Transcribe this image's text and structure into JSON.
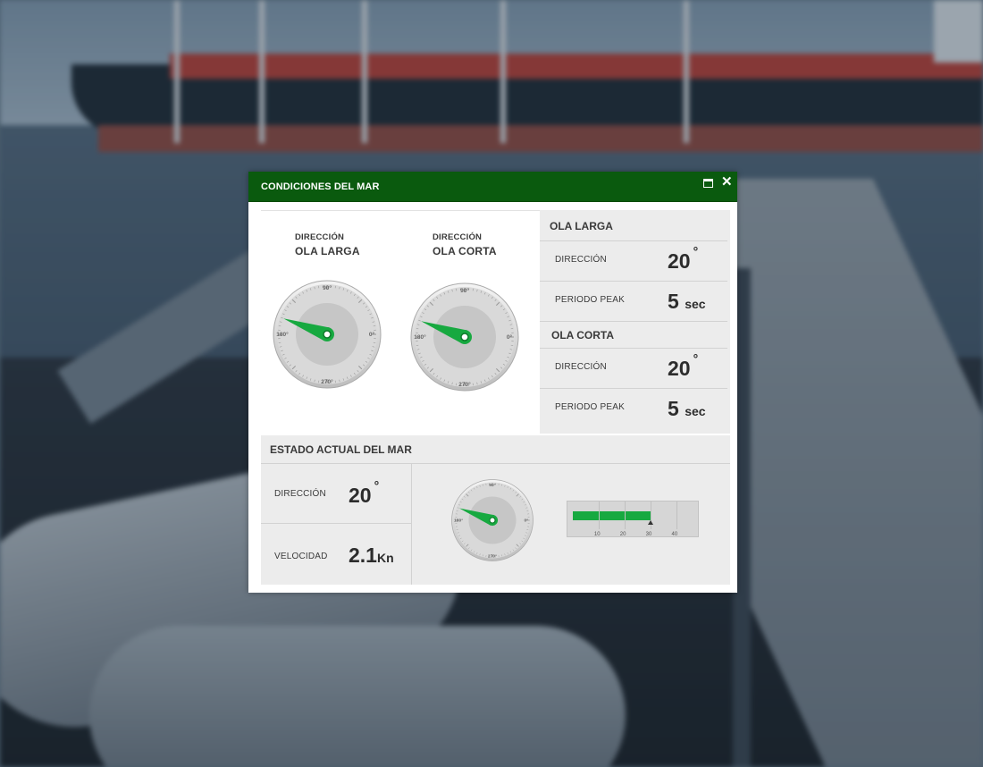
{
  "window": {
    "title": "CONDICIONES DEL MAR",
    "maximize_icon": "window-maximize-icon",
    "close_symbol": "✕"
  },
  "gauges": {
    "long_wave": {
      "label_small": "DIRECCIÓN",
      "label_big": "OLA LARGA",
      "direction_deg": 20
    },
    "short_wave": {
      "label_small": "DIRECCIÓN",
      "label_big": "OLA CORTA",
      "direction_deg": 20
    },
    "dial_labels": {
      "top": "90°",
      "left": "180°",
      "right": "0°",
      "bottom": "270°"
    }
  },
  "long_wave_panel": {
    "title": "OLA LARGA",
    "direction_label": "DIRECCIÓN",
    "direction_value": "20",
    "direction_unit": "°",
    "period_label": "PERIODO PEAK",
    "period_value": "5",
    "period_unit": "sec"
  },
  "short_wave_panel": {
    "title": "OLA CORTA",
    "direction_label": "DIRECCIÓN",
    "direction_value": "20",
    "direction_unit": "°",
    "period_label": "PERIODO PEAK",
    "period_value": "5",
    "period_unit": "sec"
  },
  "current_state": {
    "title": "ESTADO ACTUAL DEL MAR",
    "direction_label": "DIRECCIÓN",
    "direction_value": "20",
    "direction_unit": "°",
    "speed_label": "VELOCIDAD",
    "speed_value": "2.1",
    "speed_unit": "Kn",
    "gauge_direction_deg": 20,
    "bar": {
      "value": 30,
      "max": 45,
      "ticks": [
        "10",
        "20",
        "30",
        "40"
      ],
      "tick_values": [
        10,
        20,
        30,
        40
      ]
    }
  },
  "colors": {
    "title_bar": "#0a5a0e",
    "needle": "#17a940",
    "panel_bg": "#ececec"
  }
}
